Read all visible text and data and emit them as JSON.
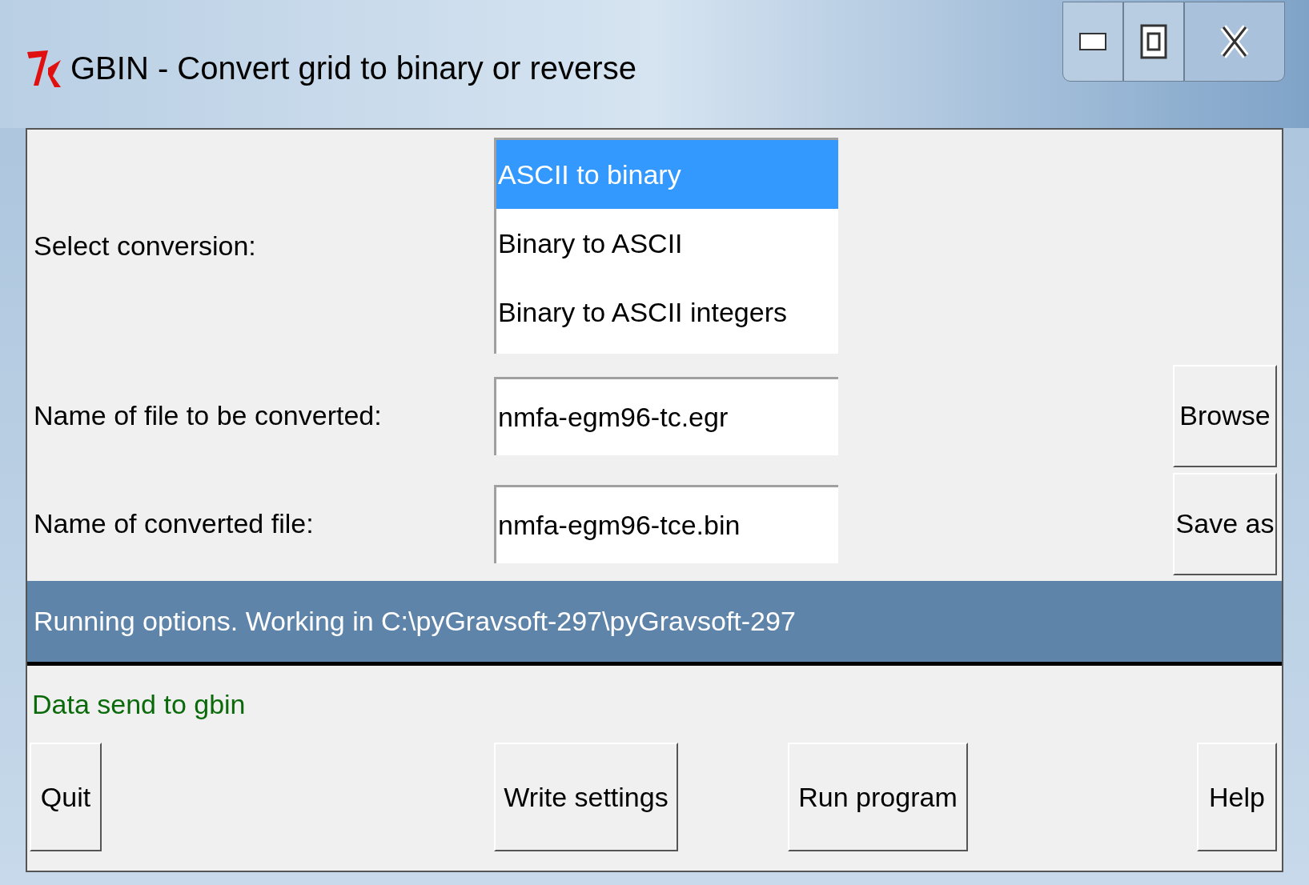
{
  "window": {
    "title": "GBIN - Convert grid to binary or reverse"
  },
  "conversion": {
    "label": "Select conversion:",
    "options": [
      {
        "label": "ASCII to binary",
        "selected": true
      },
      {
        "label": "Binary to ASCII",
        "selected": false
      },
      {
        "label": "Binary to ASCII integers",
        "selected": false
      }
    ]
  },
  "files": [
    {
      "label": "Name of file to be converted:",
      "value": "nmfa-egm96-tc.egr",
      "button": "Browse"
    },
    {
      "label": "Name of converted file:",
      "value": "nmfa-egm96-tce.bin",
      "button": "Save as"
    }
  ],
  "options_bar": "Running options. Working in C:\\pyGravsoft-297\\pyGravsoft-297",
  "status": "Data send to gbin",
  "buttons": [
    "Quit",
    "Write settings",
    "Run program",
    "Help"
  ]
}
